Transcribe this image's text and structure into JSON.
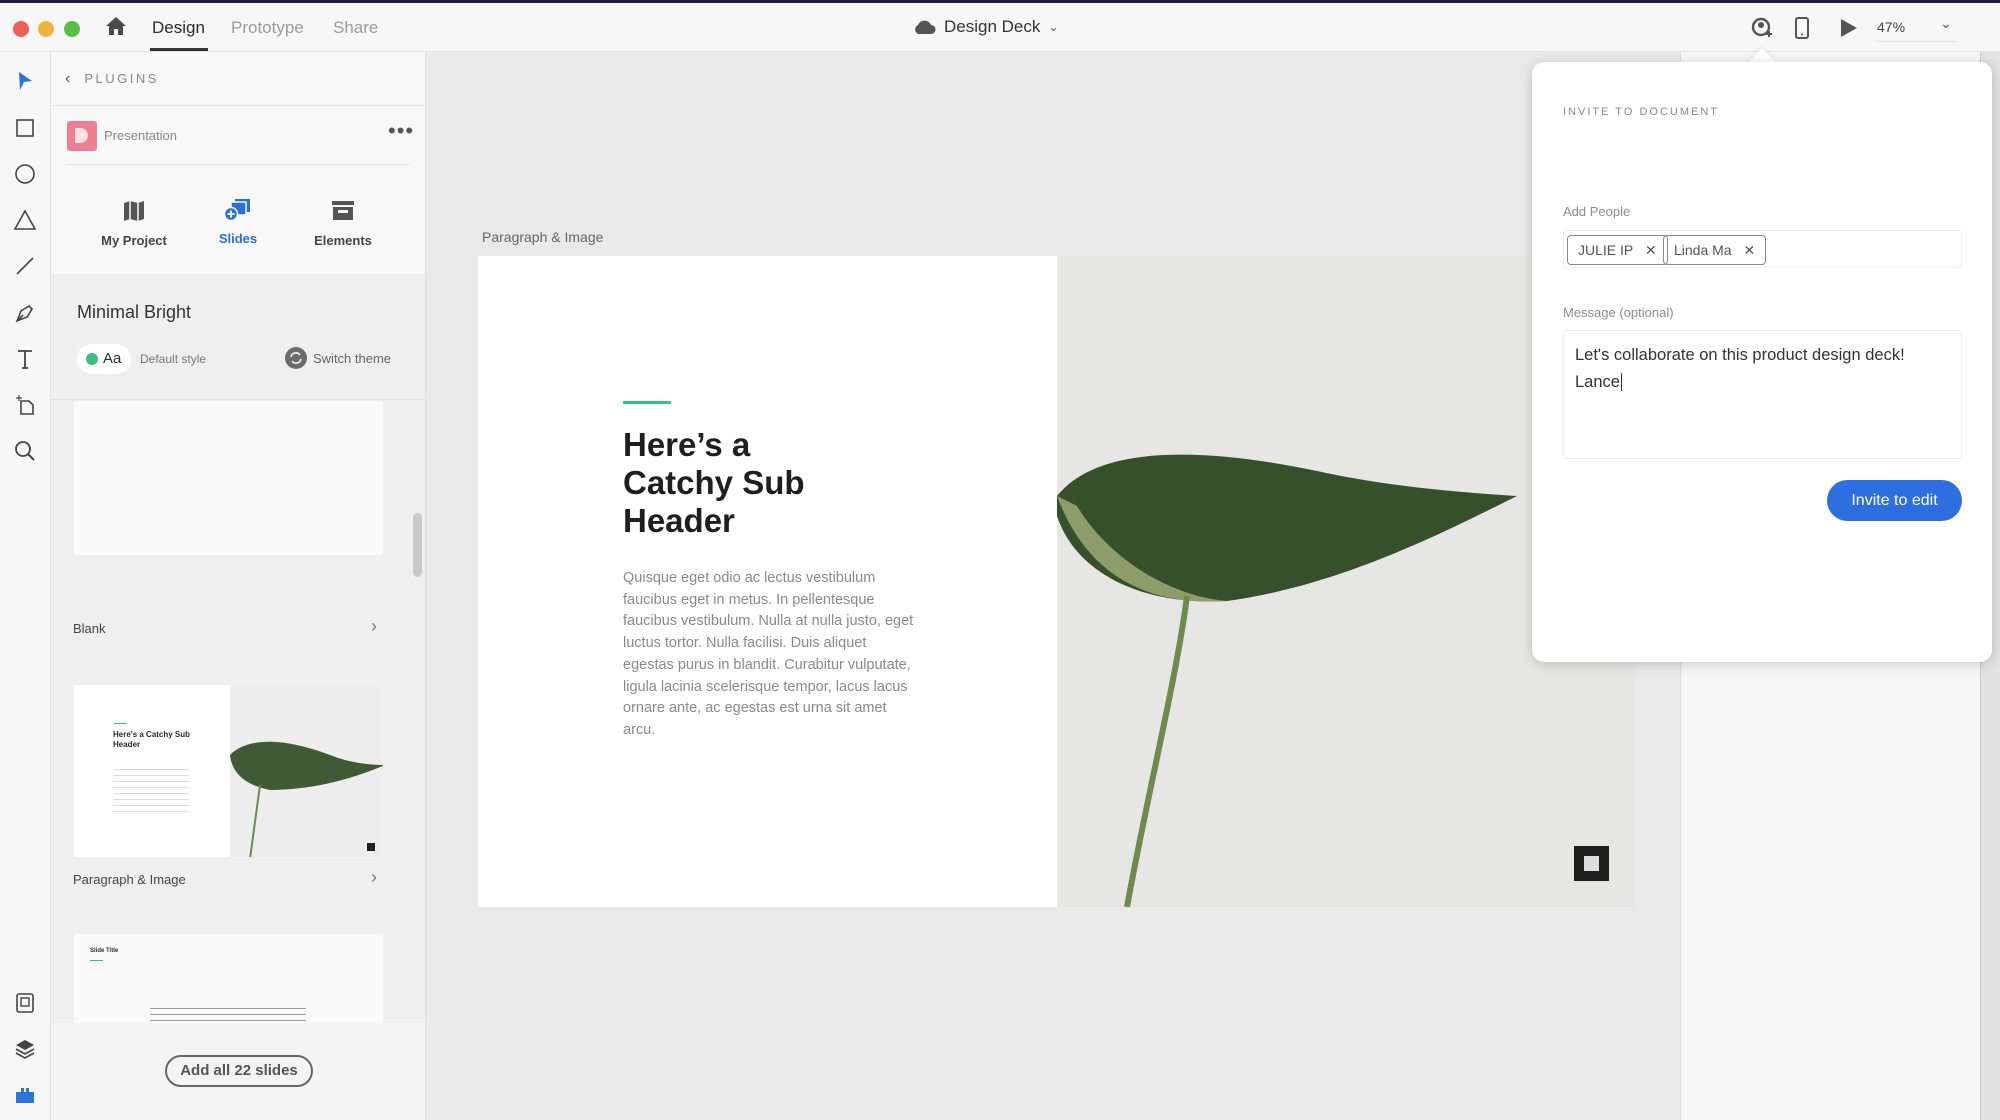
{
  "header": {
    "tabs": [
      {
        "label": "Design",
        "active": true
      },
      {
        "label": "Prototype"
      },
      {
        "label": "Share"
      }
    ],
    "doc_title": "Design Deck",
    "zoom": "47%"
  },
  "panel": {
    "back_label": "PLUGINS",
    "plugin_name": "Presentation",
    "tabs": [
      {
        "label": "My Project",
        "icon": "map-icon"
      },
      {
        "label": "Slides",
        "icon": "slides-add-icon",
        "active": true
      },
      {
        "label": "Elements",
        "icon": "archive-icon"
      }
    ],
    "theme_name": "Minimal Bright",
    "style_sample": "Aa",
    "style_label": "Default style",
    "switch_theme": "Switch theme",
    "slides": [
      {
        "label": "Blank"
      },
      {
        "label": "Paragraph & Image"
      },
      {
        "label": "",
        "title": "Slide Title"
      }
    ],
    "add_all": "Add all 22 slides"
  },
  "thumb2": {
    "heading": "Here's a Catchy Sub Header"
  },
  "canvas": {
    "artboard_label": "Paragraph & Image",
    "slide": {
      "heading_lines": [
        "Here’s a",
        "Catchy Sub",
        "Header"
      ],
      "body": "Quisque eget odio ac lectus vestibulum faucibus eget in metus. In pellentesque faucibus vestibulum. Nulla at nulla justo, eget luctus tortor. Nulla facilisi. Duis aliquet egestas purus in blandit. Curabitur vulputate, ligula lacinia scelerisque tempor, lacus lacus ornare ante, ac egestas est urna sit amet arcu.",
      "accent": "#2fbf8f"
    }
  },
  "invite": {
    "title": "INVITE TO DOCUMENT",
    "add_people_label": "Add People",
    "people": [
      "JULIE IP",
      "Linda Ma"
    ],
    "message_label": "Message (optional)",
    "message_lines": [
      "Let's collaborate on this product design deck!",
      "Lance"
    ],
    "button": "Invite to edit",
    "button_color": "#2d6fdf"
  }
}
